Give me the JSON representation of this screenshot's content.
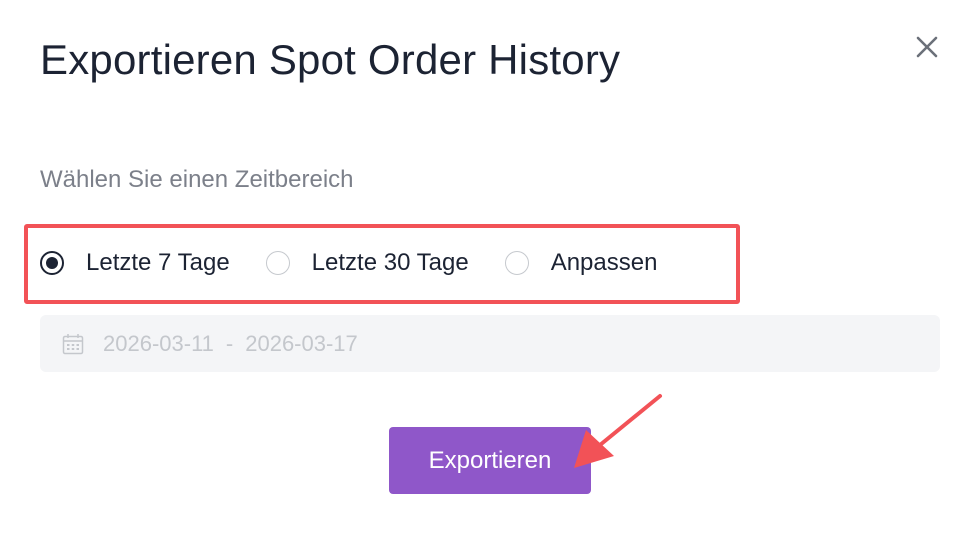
{
  "dialog": {
    "title": "Exportieren Spot Order History",
    "subtitle": "Wählen Sie einen Zeitbereich",
    "close_icon": "close-icon"
  },
  "time_range": {
    "options": [
      {
        "label": "Letzte 7 Tage",
        "selected": true
      },
      {
        "label": "Letzte 30 Tage",
        "selected": false
      },
      {
        "label": "Anpassen",
        "selected": false
      }
    ]
  },
  "date_range": {
    "icon": "calendar-icon",
    "start": "2026-03-11",
    "separator": "-",
    "end": "2026-03-17"
  },
  "actions": {
    "export_label": "Exportieren"
  },
  "colors": {
    "accent": "#8f57c9",
    "annotation": "#f25257",
    "text": "#1c2333",
    "muted": "#7c808a"
  }
}
